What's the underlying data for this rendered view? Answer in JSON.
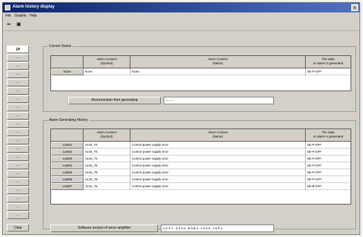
{
  "window": {
    "title": "Alarm history display"
  },
  "menu": [
    "File",
    "Graphic",
    "Help"
  ],
  "toolbar": [
    "⇐",
    "▣"
  ],
  "sidebar": [
    "1P",
    "—",
    "—",
    "—",
    "—",
    "—",
    "—",
    "—",
    "—",
    "—",
    "—",
    "—",
    "—",
    "—",
    "—",
    "—",
    "—",
    "—",
    "—",
    "—",
    "—",
    "Clear"
  ],
  "current": {
    "label": "Current Status",
    "headers": [
      [
        "Alarm Content",
        "(Symbol)"
      ],
      [
        "Alarm Content",
        "(Name)"
      ],
      [
        "The state",
        "on alarm is generated"
      ]
    ],
    "row": {
      "button": "None",
      "symbol": "None",
      "name": "None",
      "state": "SE-P-OFF"
    },
    "reset_button": "Reconnection from generating",
    "reset_value": "— —"
  },
  "history": {
    "label": "Alarm Generating History",
    "headers": [
      [
        "Alarm Content",
        "(Symbol)"
      ],
      [
        "Alarm Content",
        "(Name)"
      ],
      [
        "The state",
        "on alarm is generated"
      ]
    ],
    "rows": [
      {
        "button": "Last01",
        "symbol": "AL04_75",
        "name": "Control power supply error",
        "state": "SE-P-OFF"
      },
      {
        "button": "Last02",
        "symbol": "AL04_75",
        "name": "Control power supply error",
        "state": "SE-P-OFF"
      },
      {
        "button": "Last03",
        "symbol": "AL04_75",
        "name": "Control power supply error",
        "state": "SE-P-OFF"
      },
      {
        "button": "Last04",
        "symbol": "AL04_75",
        "name": "Control power supply error",
        "state": "SE-P-OFF"
      },
      {
        "button": "Last05",
        "symbol": "AL04_75",
        "name": "Control power supply error",
        "state": "SE-P-OFF"
      },
      {
        "button": "Last06",
        "symbol": "AL04_75",
        "name": "Control power supply error",
        "state": "SE-P-OFF"
      },
      {
        "button": "Last07",
        "symbol": "AL04_75",
        "name": "Control power supply error",
        "state": "SE-B-OFF"
      }
    ]
  },
  "software": {
    "button": "Software version of servo amplifier",
    "value": "A C F  7  . 0 2 2 0  . B 0 B 3 . A 0 0 0 . 4 5 P 1"
  }
}
